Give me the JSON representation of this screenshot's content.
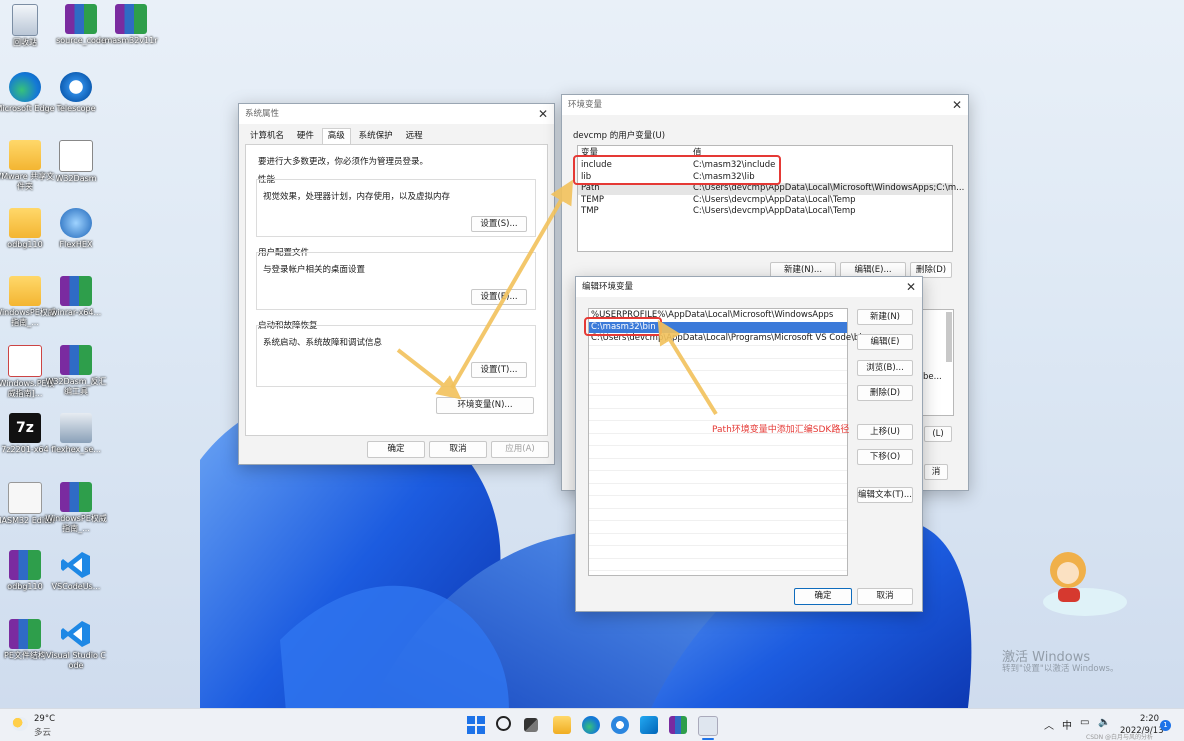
{
  "desktop": {
    "icons": [
      {
        "label": "回收站",
        "kind": "bin"
      },
      {
        "label": "source_code",
        "kind": "rar"
      },
      {
        "label": "masm32v11r",
        "kind": "rar"
      },
      {
        "label": "Microsoft Edge",
        "kind": "edge"
      },
      {
        "label": "Telescope",
        "kind": "tele"
      },
      {
        "label": "VMware 共享文件夹",
        "kind": "folder"
      },
      {
        "label": "W32Dasm",
        "kind": "w32"
      },
      {
        "label": "odbg110",
        "kind": "folder"
      },
      {
        "label": "FlexHEX",
        "kind": "flex"
      },
      {
        "label": "WindowsPE权威指南_...",
        "kind": "folder"
      },
      {
        "label": "winrar-x64...",
        "kind": "rar"
      },
      {
        "label": "[Windows.PE权威指南]...",
        "kind": "pdf"
      },
      {
        "label": "W32Dasm_反汇编工具",
        "kind": "rar"
      },
      {
        "label": "7z2201-x64",
        "kind": "7z"
      },
      {
        "label": "flexhex_se...",
        "kind": "inst"
      },
      {
        "label": "MASM32 Editor",
        "kind": "masm"
      },
      {
        "label": "WindowsPE权威指南_...",
        "kind": "rar"
      },
      {
        "label": "odbg110",
        "kind": "rar"
      },
      {
        "label": "VSCodeUs...",
        "kind": "vsc"
      },
      {
        "label": "PE文件结构",
        "kind": "rar"
      },
      {
        "label": "Visual Studio Code",
        "kind": "vsc"
      }
    ],
    "watermark_title": "激活 Windows",
    "watermark_sub": "转到\"设置\"以激活 Windows。"
  },
  "sysprop": {
    "title": "系统属性",
    "tabs": [
      "计算机名",
      "硬件",
      "高级",
      "系统保护",
      "远程"
    ],
    "notice": "要进行大多数更改，你必须作为管理员登录。",
    "perf_title": "性能",
    "perf_desc": "视觉效果，处理器计划，内存使用，以及虚拟内存",
    "perf_btn": "设置(S)...",
    "profile_title": "用户配置文件",
    "profile_desc": "与登录帐户相关的桌面设置",
    "profile_btn": "设置(E)...",
    "startup_title": "启动和故障恢复",
    "startup_desc": "系统启动、系统故障和调试信息",
    "startup_btn": "设置(T)...",
    "envvar_btn": "环境变量(N)...",
    "ok": "确定",
    "cancel": "取消",
    "apply": "应用(A)"
  },
  "envvars": {
    "title": "环境变量",
    "user_section": "devcmp 的用户变量(U)",
    "col_var": "变量",
    "col_val": "值",
    "rows": [
      {
        "name": "include",
        "value": "C:\\masm32\\include"
      },
      {
        "name": "lib",
        "value": "C:\\masm32\\lib"
      },
      {
        "name": "Path",
        "value": "C:\\Users\\devcmp\\AppData\\Local\\Microsoft\\WindowsApps;C:\\m..."
      },
      {
        "name": "TEMP",
        "value": "C:\\Users\\devcmp\\AppData\\Local\\Temp"
      },
      {
        "name": "TMP",
        "value": "C:\\Users\\devcmp\\AppData\\Local\\Temp"
      }
    ],
    "new_btn": "新建(N)...",
    "edit_btn": "编辑(E)...",
    "delete_btn": "删除(D)",
    "sys_partial_1": "be...",
    "sys_partial_2": "(L)",
    "sys_partial_3": "消"
  },
  "editenv": {
    "title": "编辑环境变量",
    "entries": [
      "%USERPROFILE%\\AppData\\Local\\Microsoft\\WindowsApps",
      "C:\\masm32\\bin",
      "C:\\Users\\devcmp\\AppData\\Local\\Programs\\Microsoft VS Code\\bin"
    ],
    "btn_new": "新建(N)",
    "btn_edit": "编辑(E)",
    "btn_browse": "浏览(B)...",
    "btn_delete": "删除(D)",
    "btn_up": "上移(U)",
    "btn_down": "下移(O)",
    "btn_edittext": "编辑文本(T)...",
    "ok": "确定",
    "cancel": "取消"
  },
  "annotation": {
    "text": "Path环境变量中添加汇编SDK路径",
    "color": "#e53935"
  },
  "taskbar": {
    "weather_temp": "29°C",
    "weather_desc": "多云",
    "lang": "中",
    "time": "2:20",
    "date": "2022/9/13",
    "notif": "1",
    "csdn": "CSDN @白月与风的分析"
  }
}
